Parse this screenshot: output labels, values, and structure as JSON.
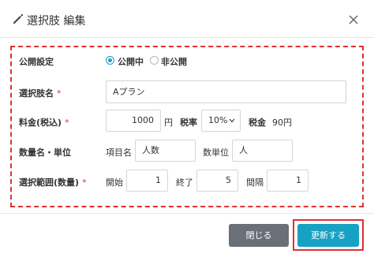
{
  "header": {
    "title": "選択肢 編集",
    "icon": "pencil-icon",
    "close_icon": "close-icon"
  },
  "form": {
    "publish": {
      "label": "公開設定",
      "options": [
        {
          "label": "公開中",
          "selected": true
        },
        {
          "label": "非公開",
          "selected": false
        }
      ]
    },
    "option_name": {
      "label": "選択肢名",
      "required_mark": "*",
      "value": "Aプラン"
    },
    "price": {
      "label": "料金(税込)",
      "required_mark": "*",
      "value": "1000",
      "unit": "円",
      "tax_label": "税率",
      "tax_value": "10%",
      "tax_amount_label": "税金",
      "tax_amount_value": "90円"
    },
    "quantity": {
      "label": "数量名・単位",
      "item_name_label": "項目名",
      "item_name_value": "人数",
      "unit_label": "数単位",
      "unit_value": "人"
    },
    "range": {
      "label": "選択範囲(数量)",
      "required_mark": "*",
      "start_label": "開始",
      "start_value": "1",
      "end_label": "終了",
      "end_value": "5",
      "interval_label": "間隔",
      "interval_value": "1"
    }
  },
  "footer": {
    "close_label": "閉じる",
    "update_label": "更新する"
  },
  "colors": {
    "accent": "#17a2c4",
    "highlight": "#e03131",
    "secondary_button": "#6b6f77"
  }
}
